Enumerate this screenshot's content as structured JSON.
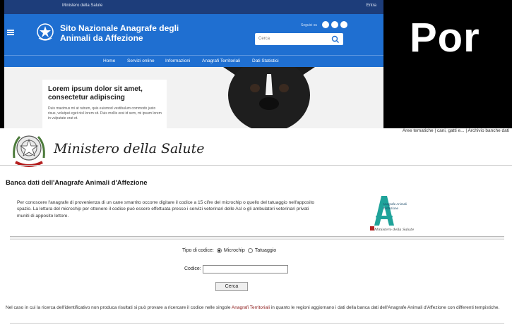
{
  "portal": {
    "util_bar_text": "Ministero della Salute",
    "util_bar_right": "Entra",
    "site_title": "Sito Nazionale Anagrafe degli Animali da Affezione",
    "social_label": "Seguici su",
    "search_placeholder": "Cerca",
    "nav": [
      "Home",
      "Servizi online",
      "Informazioni",
      "Anagrafi Territoriali",
      "Dati Statistici"
    ],
    "hero_title": "Lorem ipsum dolor sit amet, consectetur adipiscing",
    "hero_text": "Duis maximus mi at rutrum, quis euismod vestibulum commodo justo risus, volutpat eget nisl lorem sit. Duis mollis erat id sem, mi ipsum lorem in vulputate erat et."
  },
  "banner_text": "Por",
  "breadcrumb": "Aree tematiche | cani, gatti e...  |  Archivio banche dati",
  "ministry_name": "Ministero della Salute",
  "page_title": "Banca dati dell'Anagrafe Animali d'Affezione",
  "intro": "Per conoscere l'anagrafe di provenienza di un cane smarrito occorre digitare il codice a 15 cifre del microchip o quello del tatuaggio nell'apposito spazio. La lettura del microchip per ottenere il codice può essere effettuata presso i servizi veterinari delle Asl o gli ambulatori veterinari privati muniti di apposito lettore.",
  "logo": {
    "text": "Anagrafe Animali d'Affezione",
    "ministry": "Ministero della Salute"
  },
  "form": {
    "type_label": "Tipo di codice:",
    "option_microchip": "Microchip",
    "option_tattoo": "Tatuaggio",
    "selected": "Microchip",
    "code_label": "Codice:",
    "code_value": "",
    "submit_label": "Cerca"
  },
  "footer": {
    "before_link": "Nel caso in cui la ricerca dell'identificativo non produca risultati si può provare a ricercare il codice nelle singole ",
    "link": "Anagrafi Territoriali",
    "after_link": " in quanto le regioni aggiornano i dati della banca dati dell'Anagrafe Animali d'Affezione con differenti tempistiche."
  },
  "colors": {
    "header_blue": "#1f6fd1",
    "util_navy": "#1d3d7a",
    "link_red": "#8b1a1a"
  }
}
